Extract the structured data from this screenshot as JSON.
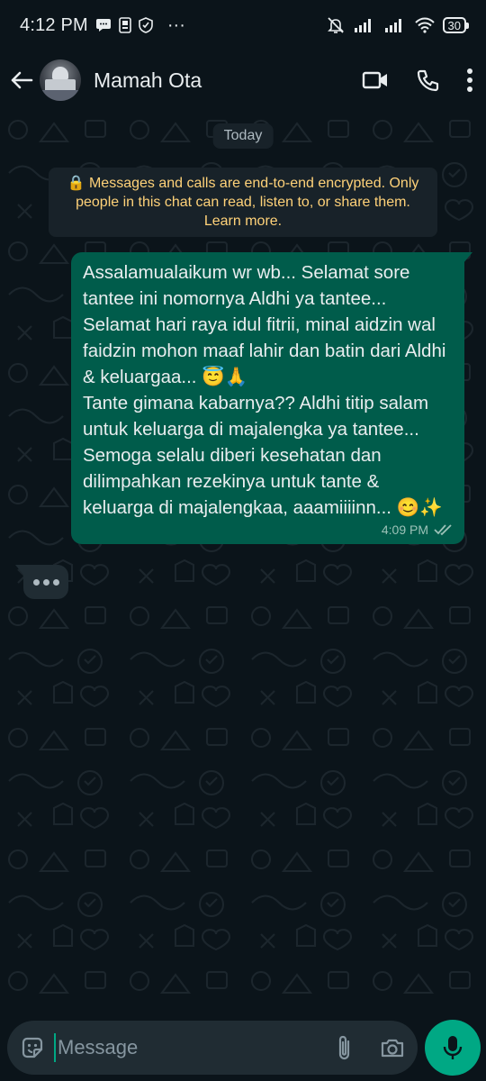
{
  "status_bar": {
    "time": "4:12 PM",
    "battery": "30",
    "ellipsis": "···"
  },
  "header": {
    "contact_name": "Mamah Ota"
  },
  "chat": {
    "date_chip": "Today",
    "encryption_notice": "🔒 Messages and calls are end-to-end encrypted. Only people in this chat can read, listen to, or share them. Learn more.",
    "messages": [
      {
        "direction": "outgoing",
        "text": "Assalamualaikum wr wb... Selamat sore tantee ini nomornya Aldhi ya tantee... Selamat hari raya idul fitrii, minal aidzin wal faidzin mohon maaf lahir dan batin dari Aldhi & keluargaa... 😇🙏\nTante gimana kabarnya?? Aldhi titip salam untuk keluarga di majalengka ya tantee... Semoga selalu diberi kesehatan dan dilimpahkan rezekinya untuk tante & keluarga di majalengkaa, aaamiiiinn... 😊✨",
        "time": "4:09 PM",
        "status": "delivered"
      }
    ]
  },
  "composer": {
    "placeholder": "Message"
  },
  "colors": {
    "background": "#0b141a",
    "outgoing_bubble": "#005c4b",
    "accent": "#00a884",
    "notice_text": "#ffd279"
  }
}
